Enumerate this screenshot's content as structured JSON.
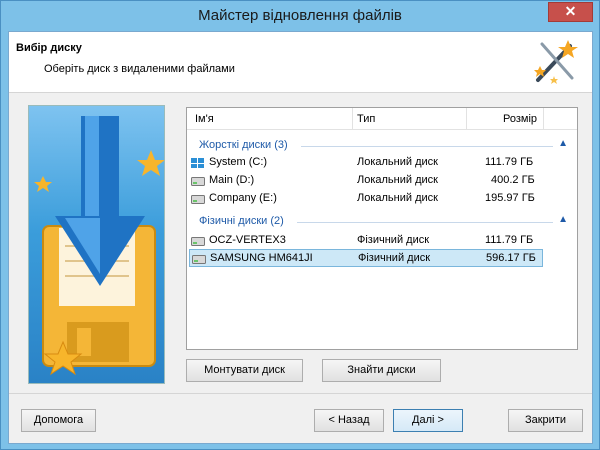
{
  "window": {
    "title": "Майстер відновлення файлів",
    "close_glyph": "✕"
  },
  "header": {
    "title": "Вибір диску",
    "subtitle": "Оберіть диск з видаленими файлами"
  },
  "list": {
    "columns": [
      "Ім'я",
      "Тип",
      "Розмір"
    ],
    "groups": [
      {
        "label": "Жорсткі диски (3)",
        "items": [
          {
            "name": "System (C:)",
            "type": "Локальний диск",
            "size": "111.79 ГБ",
            "icon": "windows-drive-icon"
          },
          {
            "name": "Main (D:)",
            "type": "Локальний диск",
            "size": "400.2 ГБ",
            "icon": "hard-drive-icon"
          },
          {
            "name": "Company (E:)",
            "type": "Локальний диск",
            "size": "195.97 ГБ",
            "icon": "hard-drive-icon"
          }
        ]
      },
      {
        "label": "Фізичні диски (2)",
        "items": [
          {
            "name": "OCZ-VERTEX3",
            "type": "Фізичний диск",
            "size": "111.79 ГБ",
            "icon": "hard-drive-icon"
          },
          {
            "name": "SAMSUNG HM641JI",
            "type": "Фізичний диск",
            "size": "596.17 ГБ",
            "icon": "hard-drive-icon",
            "selected": true
          }
        ]
      }
    ],
    "collapse_glyph": "▲"
  },
  "buttons": {
    "mount": "Монтувати диск",
    "find": "Знайти диски",
    "help": "Допомога",
    "back": "< Назад",
    "next": "Далі >",
    "close": "Закрити"
  },
  "colors": {
    "accent": "#1e5aa8",
    "selection": "#cde8f7",
    "close": "#c7504b"
  }
}
